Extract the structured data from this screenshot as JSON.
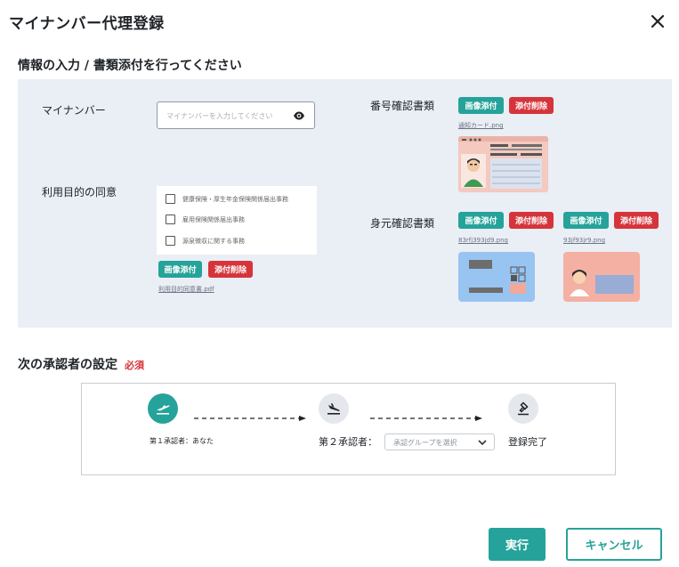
{
  "dialog": {
    "title": "マイナンバー代理登録",
    "close_icon": "close-icon"
  },
  "section_docs": {
    "title": "情報の入力 / 書類添付を行ってください",
    "mynumber": {
      "label": "マイナンバー",
      "placeholder": "マイナンバーを入力してください",
      "toggle_icon": "eye-icon"
    },
    "consent": {
      "label": "利用目的の同意",
      "items": [
        {
          "text": "健康保険・厚生年金保険関係届出事務",
          "checked": false
        },
        {
          "text": "雇用保険関係届出事務",
          "checked": false
        },
        {
          "text": "源泉徴収に関する事務",
          "checked": false
        }
      ],
      "attach_label": "画像添付",
      "delete_label": "添付削除",
      "file_name": "利用目的同意書.pdf"
    },
    "number_doc": {
      "label": "番号確認書類",
      "attach_label": "画像添付",
      "delete_label": "添付削除",
      "file_name": "通知カード.png"
    },
    "identity_doc": {
      "label": "身元確認書類",
      "attach_label_1": "画像添付",
      "delete_label_1": "添付削除",
      "file_name_1": "83rfj393jd9.png",
      "attach_label_2": "画像添付",
      "delete_label_2": "添付削除",
      "file_name_2": "93jf93jr9.png"
    }
  },
  "section_approver": {
    "title": "次の承認者の設定",
    "required_label": "必須",
    "steps": [
      {
        "label": "第１承認者：あなた",
        "icon": "plane-departure-icon",
        "active": true
      },
      {
        "label": "第２承認者：",
        "icon": "plane-landing-icon",
        "active": false
      },
      {
        "label": "登録完了",
        "icon": "stamp-icon",
        "active": false
      }
    ],
    "approver_group_placeholder": "承認グループを選択"
  },
  "footer": {
    "submit_label": "実行",
    "cancel_label": "キャンセル"
  },
  "colors": {
    "accent": "#25a39a",
    "danger": "#d6343b",
    "panel_bg": "#eaeef5"
  }
}
